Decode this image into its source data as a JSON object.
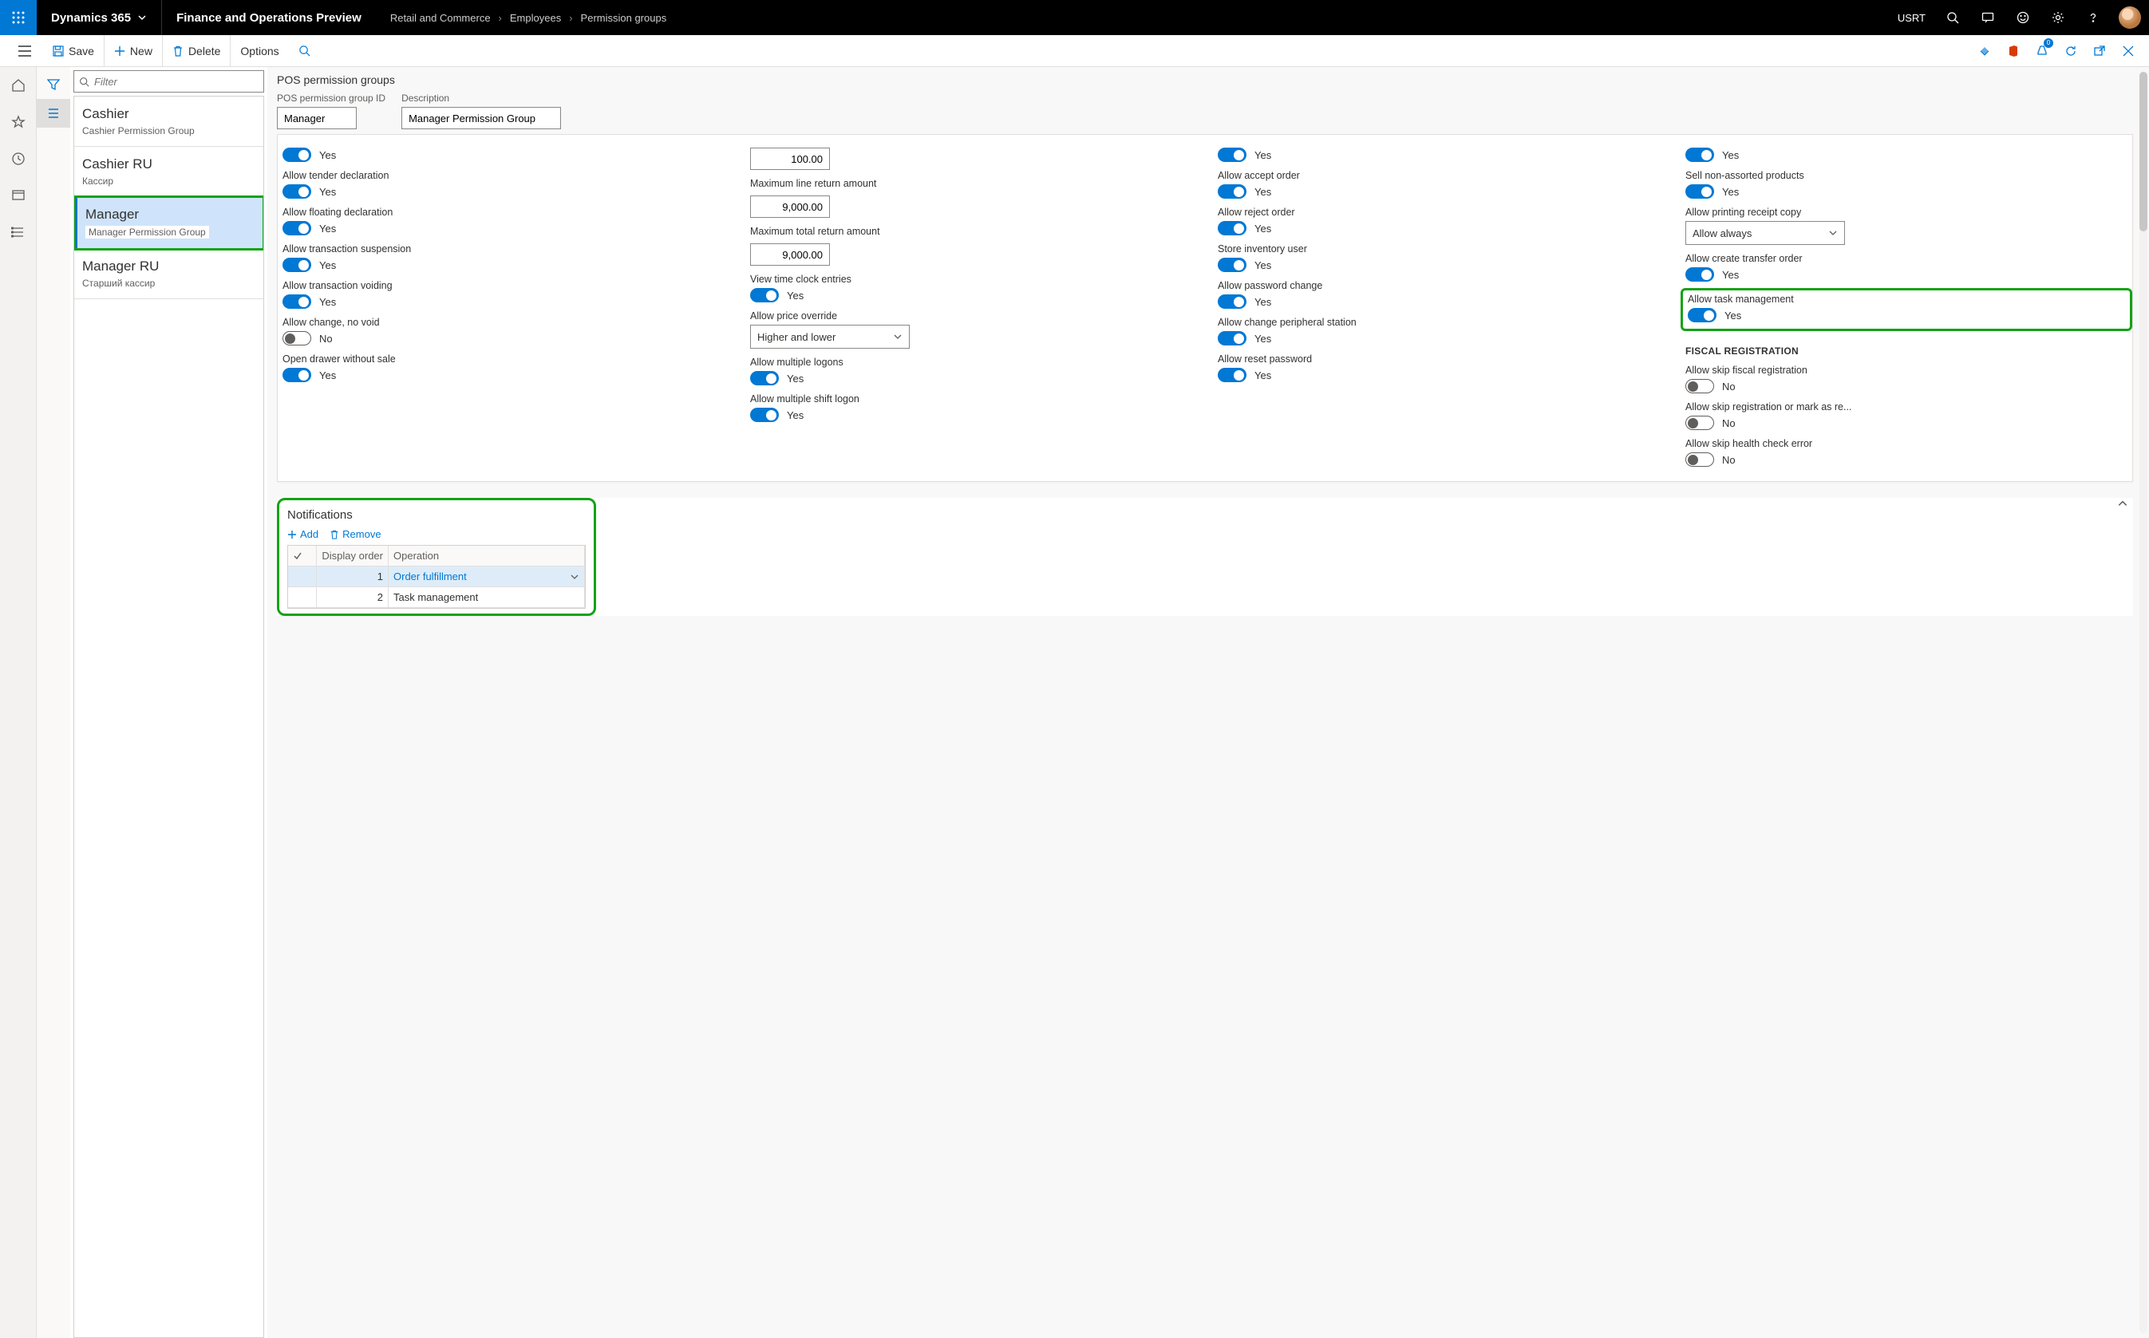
{
  "topbar": {
    "brand": "Dynamics 365",
    "page_title": "Finance and Operations Preview",
    "breadcrumb": [
      "Retail and Commerce",
      "Employees",
      "Permission groups"
    ],
    "company": "USRT"
  },
  "actionbar": {
    "save": "Save",
    "new": "New",
    "delete": "Delete",
    "options": "Options",
    "badge_count": "0"
  },
  "list": {
    "filter_placeholder": "Filter",
    "items": [
      {
        "title": "Cashier",
        "sub": "Cashier Permission Group"
      },
      {
        "title": "Cashier RU",
        "sub": "Кассир"
      },
      {
        "title": "Manager",
        "sub": "Manager Permission Group"
      },
      {
        "title": "Manager RU",
        "sub": "Старший кассир"
      }
    ]
  },
  "content": {
    "section_title": "POS permission groups",
    "id_label": "POS permission group ID",
    "id_value": "Manager",
    "desc_label": "Description",
    "desc_value": "Manager Permission Group",
    "col1": [
      {
        "label": "",
        "toggle": true,
        "value": "Yes",
        "on": true
      },
      {
        "label": "Allow tender declaration",
        "toggle": true,
        "value": "Yes",
        "on": true
      },
      {
        "label": "Allow floating declaration",
        "toggle": true,
        "value": "Yes",
        "on": true
      },
      {
        "label": "Allow transaction suspension",
        "toggle": true,
        "value": "Yes",
        "on": true
      },
      {
        "label": "Allow transaction voiding",
        "toggle": true,
        "value": "Yes",
        "on": true
      },
      {
        "label": "Allow change, no void",
        "toggle": true,
        "value": "No",
        "on": false
      },
      {
        "label": "Open drawer without sale",
        "toggle": true,
        "value": "Yes",
        "on": true
      }
    ],
    "col2": [
      {
        "label": "",
        "type": "num",
        "value": "100.00"
      },
      {
        "label": "Maximum line return amount",
        "type": "num",
        "value": "9,000.00"
      },
      {
        "label": "Maximum total return amount",
        "type": "num",
        "value": "9,000.00"
      },
      {
        "label": "View time clock entries",
        "toggle": true,
        "value": "Yes",
        "on": true
      },
      {
        "label": "Allow price override",
        "type": "select",
        "value": "Higher and lower"
      },
      {
        "label": "Allow multiple logons",
        "toggle": true,
        "value": "Yes",
        "on": true
      },
      {
        "label": "Allow multiple shift logon",
        "toggle": true,
        "value": "Yes",
        "on": true
      }
    ],
    "col3": [
      {
        "label": "",
        "toggle": true,
        "value": "Yes",
        "on": true
      },
      {
        "label": "Allow accept order",
        "toggle": true,
        "value": "Yes",
        "on": true
      },
      {
        "label": "Allow reject order",
        "toggle": true,
        "value": "Yes",
        "on": true
      },
      {
        "label": "Store inventory user",
        "toggle": true,
        "value": "Yes",
        "on": true
      },
      {
        "label": "Allow password change",
        "toggle": true,
        "value": "Yes",
        "on": true
      },
      {
        "label": "Allow change peripheral station",
        "toggle": true,
        "value": "Yes",
        "on": true
      },
      {
        "label": "Allow reset password",
        "toggle": true,
        "value": "Yes",
        "on": true
      }
    ],
    "col4": [
      {
        "label": "",
        "toggle": true,
        "value": "Yes",
        "on": true
      },
      {
        "label": "Sell non-assorted products",
        "toggle": true,
        "value": "Yes",
        "on": true
      },
      {
        "label": "Allow printing receipt copy",
        "type": "select",
        "value": "Allow always"
      },
      {
        "label": "Allow create transfer order",
        "toggle": true,
        "value": "Yes",
        "on": true
      },
      {
        "label": "Allow task management",
        "toggle": true,
        "value": "Yes",
        "on": true,
        "highlighted": true
      },
      {
        "heading": "FISCAL REGISTRATION"
      },
      {
        "label": "Allow skip fiscal registration",
        "toggle": true,
        "value": "No",
        "on": false
      },
      {
        "label": "Allow skip registration or mark as re...",
        "toggle": true,
        "value": "No",
        "on": false
      },
      {
        "label": "Allow skip health check error",
        "toggle": true,
        "value": "No",
        "on": false
      }
    ]
  },
  "notifications": {
    "title": "Notifications",
    "add": "Add",
    "remove": "Remove",
    "col_display": "Display order",
    "col_operation": "Operation",
    "rows": [
      {
        "order": "1",
        "operation": "Order fulfillment",
        "selected": true
      },
      {
        "order": "2",
        "operation": "Task management",
        "selected": false
      }
    ]
  }
}
